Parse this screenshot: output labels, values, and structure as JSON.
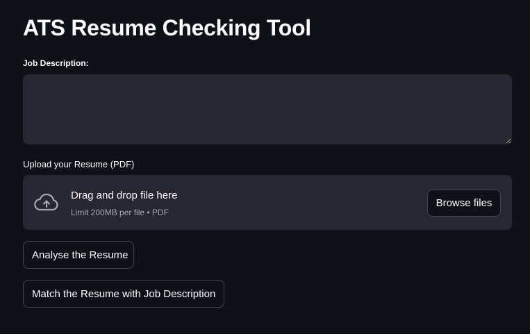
{
  "page": {
    "title": "ATS Resume Checking Tool"
  },
  "job_description": {
    "label": "Job Description:",
    "value": "",
    "placeholder": ""
  },
  "upload": {
    "label": "Upload your Resume (PDF)",
    "dropzone_title": "Drag and drop file here",
    "dropzone_subtitle": "Limit 200MB per file • PDF",
    "icon": "cloud-upload-icon",
    "browse_label": "Browse files"
  },
  "actions": {
    "analyse_label": "Analyse the Resume",
    "match_label": "Match the Resume with Job Description"
  },
  "colors": {
    "background": "#0e1117",
    "input_background": "#262730",
    "text": "#fafafa",
    "muted_text": "#a3a8b4",
    "button_border": "#44464f"
  }
}
